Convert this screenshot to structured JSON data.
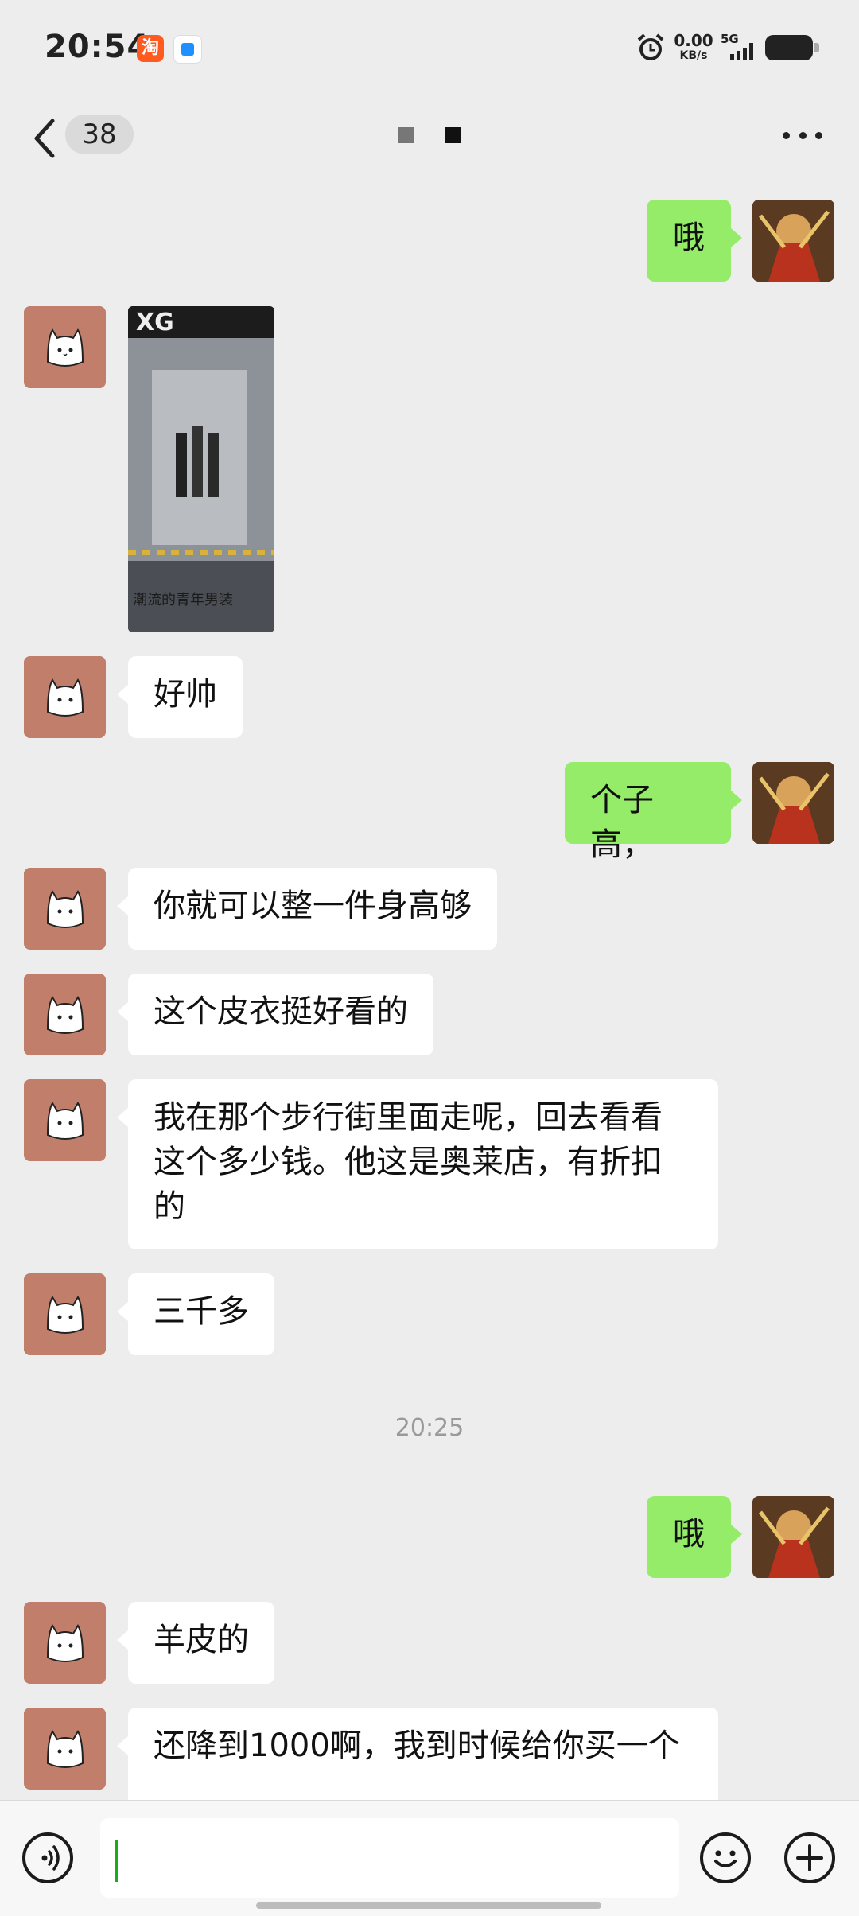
{
  "status_bar": {
    "time": "20:54",
    "taobao_glyph": "淘",
    "net_speed": "0.00",
    "net_unit": "KB/s",
    "network": "5G"
  },
  "nav": {
    "unread_count": "38"
  },
  "messages": [
    {
      "side": "out",
      "text": "哦"
    },
    {
      "side": "in",
      "type": "image",
      "image_text": "XG",
      "caption": "潮流的青年男装"
    },
    {
      "side": "in",
      "text": "好帅"
    },
    {
      "side": "out",
      "text": "个子高，"
    },
    {
      "side": "in",
      "text": "你就可以整一件身高够"
    },
    {
      "side": "in",
      "text": "这个皮衣挺好看的"
    },
    {
      "side": "in",
      "text": "我在那个步行街里面走呢，回去看看这个多少钱。他这是奥莱店，有折扣的"
    },
    {
      "side": "in",
      "text": "三千多"
    },
    {
      "type": "timestamp",
      "text": "20:25"
    },
    {
      "side": "out",
      "text": "哦"
    },
    {
      "side": "in",
      "text": "羊皮的"
    },
    {
      "side": "in",
      "text": "还降到1000啊，我到时候给你买一个"
    }
  ],
  "input": {
    "value": ""
  },
  "icons": {
    "back": "chevron-left-icon",
    "more": "more-dots-icon",
    "voice": "voice-icon",
    "emoji": "emoji-icon",
    "plus": "plus-icon",
    "alarm": "alarm-icon"
  }
}
